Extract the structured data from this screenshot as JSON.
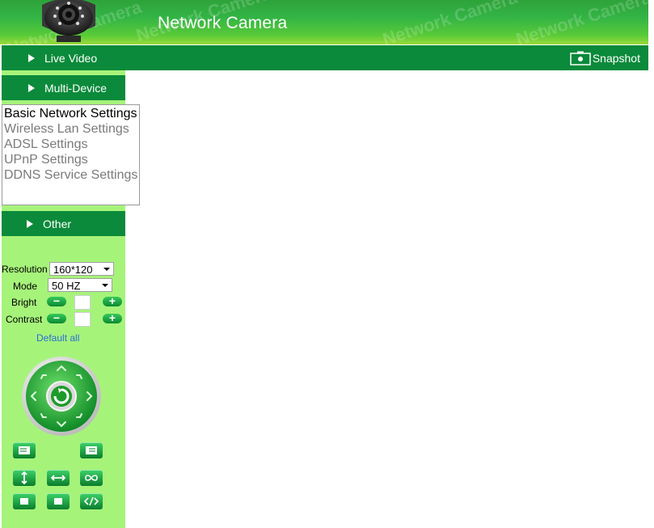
{
  "header": {
    "title": "Network Camera",
    "watermark": "Network Camera"
  },
  "toolbar": {
    "snapshot_label": "Snapshot"
  },
  "nav": {
    "live_video": "Live Video",
    "multi_device": "Multi-Device",
    "other": "Other"
  },
  "submenu": {
    "items": [
      {
        "label": "Basic Network Settings",
        "active": true
      },
      {
        "label": "Wireless Lan Settings",
        "active": false
      },
      {
        "label": "ADSL Settings",
        "active": false
      },
      {
        "label": "UPnP Settings",
        "active": false
      },
      {
        "label": "DDNS Service Settings",
        "active": false
      }
    ]
  },
  "controls": {
    "resolution_label": "Resolution",
    "resolution_value": "160*120",
    "mode_label": "Mode",
    "mode_value": "50 HZ",
    "bright_label": "Bright",
    "contrast_label": "Contrast",
    "minus": "−",
    "plus": "+",
    "default_all": "Default all"
  },
  "colors": {
    "nav_green": "#0a8a3a",
    "sidebar_bg": "#a6f37a",
    "link_blue": "#2a6fd6"
  },
  "icons": {
    "snapshot": "camera-icon",
    "ptz": "ptz-joystick-icon"
  }
}
